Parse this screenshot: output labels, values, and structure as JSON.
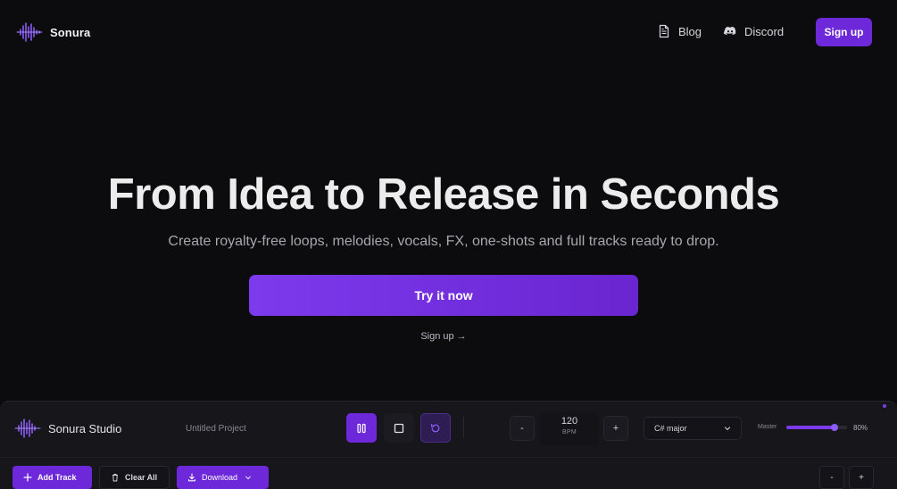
{
  "nav": {
    "brand": "Sonura",
    "blog_label": "Blog",
    "discord_label": "Discord",
    "signup_label": "Sign up"
  },
  "hero": {
    "title": "From Idea to Release in Seconds",
    "subtitle": "Create royalty-free loops, melodies, vocals, FX, one-shots and full tracks ready to drop.",
    "cta_label": "Try it now",
    "signup_link": "Sign up →"
  },
  "studio": {
    "name": "Sonura Studio",
    "project_name": "Untitled Project",
    "bpm_value": "120",
    "bpm_label": "BPM",
    "bpm_minus": "-",
    "bpm_plus": "+",
    "key_value": "C# major",
    "master_label": "Master",
    "master_level": 0.8,
    "master_value_text": "80%",
    "add_track_label": "Add Track",
    "clear_all_label": "Clear All",
    "download_label": "Download",
    "zoom_minus": "-",
    "zoom_plus": "+"
  },
  "colors": {
    "background": "#0c0b0d",
    "accent": "#6d28d9",
    "accent_light": "#7c3aed",
    "panel": "#17161b"
  },
  "icons": {
    "logo": "waveform-logo-icon",
    "blog": "document-icon",
    "discord": "discord-icon",
    "pause": "pause-icon",
    "stop": "stop-icon",
    "loop": "loop-icon",
    "add": "plus-icon",
    "clear": "trash-icon",
    "download": "download-icon",
    "chevron": "chevron-down-icon"
  }
}
